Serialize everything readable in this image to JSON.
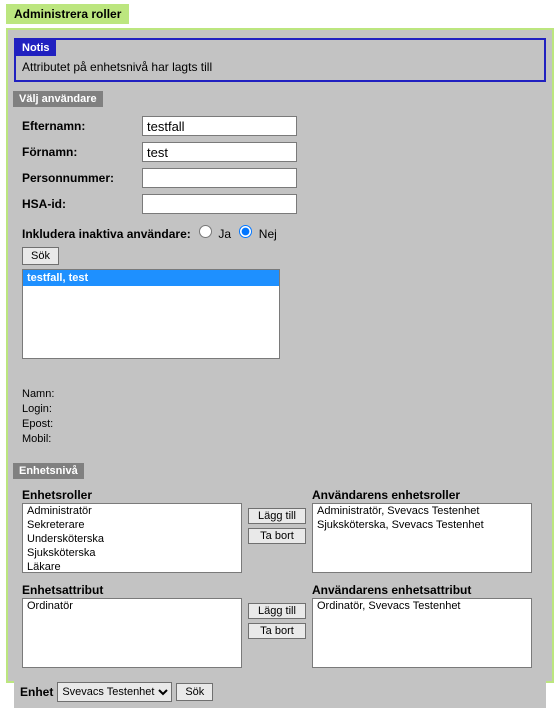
{
  "page": {
    "title": "Administrera roller"
  },
  "notice": {
    "title": "Notis",
    "body": "Attributet på enhetsnivå har lagts till"
  },
  "user_search": {
    "header": "Välj användare",
    "lastname_label": "Efternamn:",
    "lastname_value": "testfall",
    "firstname_label": "Förnamn:",
    "firstname_value": "test",
    "personnr_label": "Personnummer:",
    "personnr_value": "",
    "hsa_label": "HSA-id:",
    "hsa_value": "",
    "include_inactive_label": "Inkludera inaktiva användare:",
    "yes_label": "Ja",
    "no_label": "Nej",
    "include_inactive_value": "Nej",
    "search_btn": "Sök",
    "results": [
      {
        "label": "testfall, test",
        "selected": true
      }
    ],
    "info": {
      "name_label": "Namn:",
      "login_label": "Login:",
      "email_label": "Epost:",
      "mobile_label": "Mobil:"
    }
  },
  "unit_level": {
    "header": "Enhetsnivå",
    "roles": {
      "left_title": "Enhetsroller",
      "left_items": [
        "Administratör",
        "Sekreterare",
        "Undersköterska",
        "Sjuksköterska",
        "Läkare"
      ],
      "right_title": "Användarens enhetsroller",
      "right_items": [
        "Administratör, Svevacs Testenhet",
        "Sjuksköterska, Svevacs Testenhet"
      ],
      "add_btn": "Lägg till",
      "remove_btn": "Ta bort"
    },
    "attrs": {
      "left_title": "Enhetsattribut",
      "left_items": [
        "Ordinatör"
      ],
      "right_title": "Användarens enhetsattribut",
      "right_items": [
        "Ordinatör, Svevacs Testenhet"
      ],
      "add_btn": "Lägg till",
      "remove_btn": "Ta bort"
    },
    "unit_label": "Enhet",
    "unit_options": [
      "Svevacs Testenhet"
    ],
    "unit_selected": "Svevacs Testenhet",
    "unit_search_btn": "Sök"
  }
}
